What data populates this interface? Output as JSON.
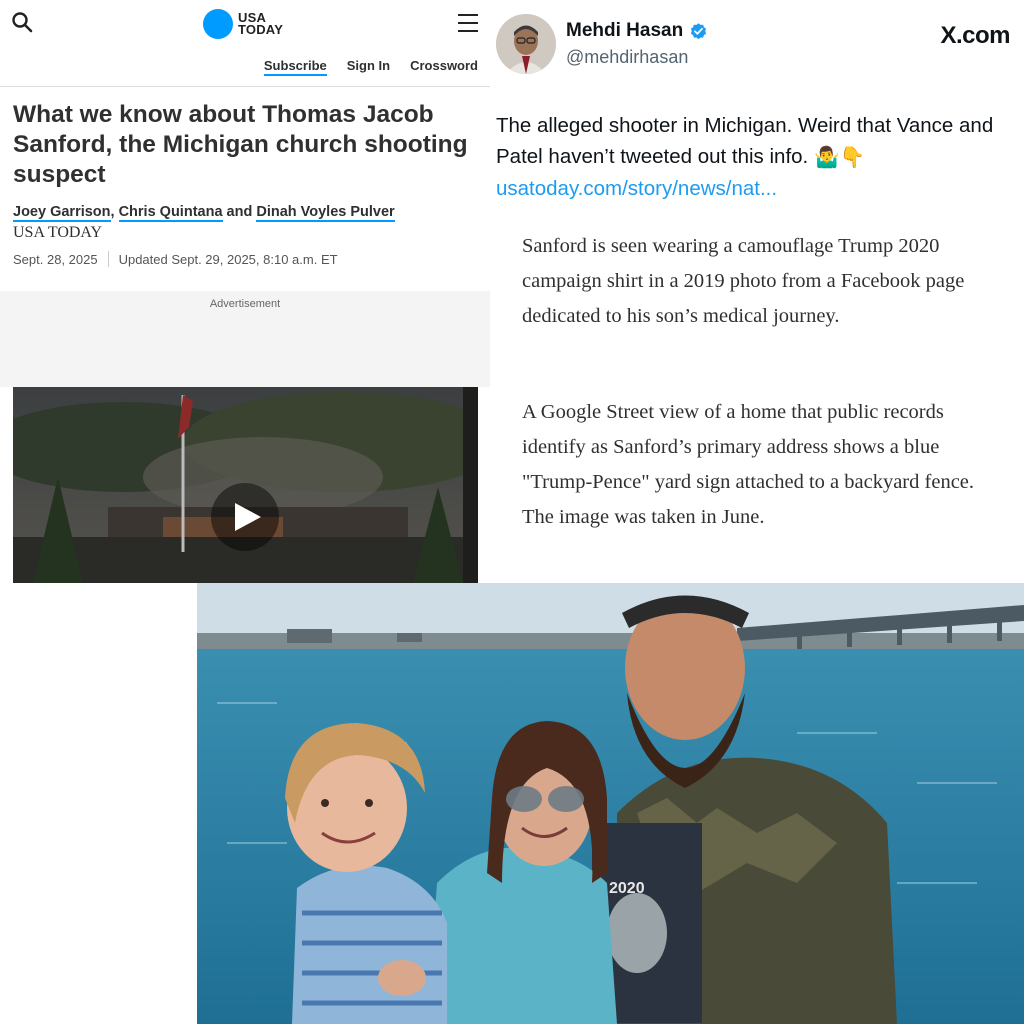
{
  "usatoday": {
    "logo_line1": "USA",
    "logo_line2": "TODAY",
    "brand_color": "#009bff",
    "nav": [
      "Subscribe",
      "Sign In",
      "Crossword"
    ],
    "headline": "What we know about Thomas Jacob Sanford, the Michigan church shooting suspect",
    "authors": [
      "Joey Garrison",
      "Chris Quintana",
      "Dinah Voyles Pulver"
    ],
    "author_sep": ",",
    "author_and": "and",
    "source": "USA TODAY",
    "date_published": "Sept. 28, 2025",
    "date_updated": "Updated Sept. 29, 2025, 8:10 a.m. ET",
    "ad_label": "Advertisement",
    "icons": [
      "search-icon",
      "menu-icon",
      "play-icon"
    ]
  },
  "tweet": {
    "display_name": "Mehdi Hasan",
    "handle": "@mehdirhasan",
    "site": "X.com",
    "verified_color": "#1d9bf0",
    "text": "The alleged shooter in Michigan. Weird that Vance and Patel haven’t tweeted out this info.",
    "emoji": "🤷‍♂️👇",
    "link": "usatoday.com/story/news/nat...",
    "quote_paragraphs": [
      "Sanford is seen wearing a camouflage Trump 2020 campaign shirt in a 2019 photo from a Facebook page dedicated to his son’s medical journey.",
      "A Google Street view of a home that public records identify as Sanford’s primary address shows a blue \"Trump-Pence\" yard sign attached to a backyard fence. The image was taken in June."
    ]
  },
  "photo": {
    "shirt_text": "2020"
  }
}
